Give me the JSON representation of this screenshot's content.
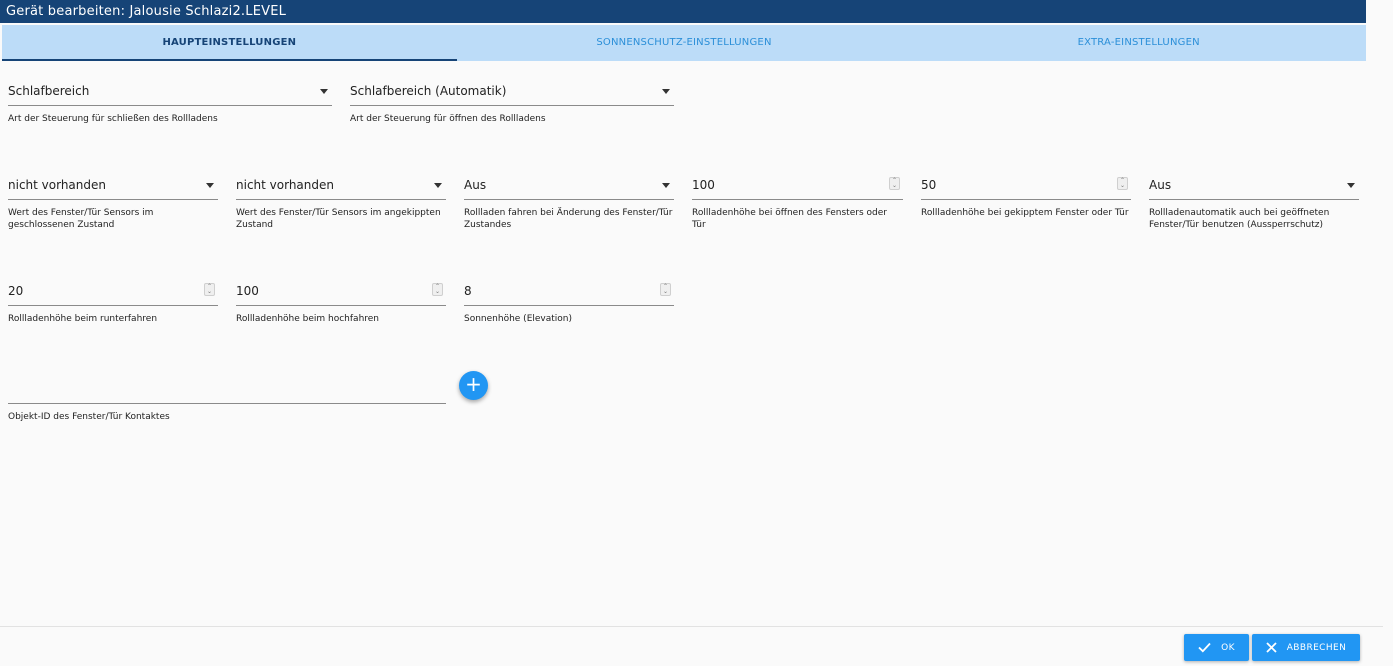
{
  "dialog": {
    "title": "Gerät bearbeiten: Jalousie Schlazi2.LEVEL"
  },
  "tabs": [
    {
      "label": "Haupteinstellungen",
      "active": true
    },
    {
      "label": "Sonnenschutz-Einstellungen",
      "active": false
    },
    {
      "label": "Extra-Einstellungen",
      "active": false
    }
  ],
  "row1": [
    {
      "value": "Schlafbereich",
      "helper": "Art der Steuerung für schließen des Rollladens"
    },
    {
      "value": "Schlafbereich (Automatik)",
      "helper": "Art der Steuerung für öffnen des Rollladens"
    }
  ],
  "row2": [
    {
      "value": "nicht vorhanden",
      "helper": "Wert des Fenster/Tür Sensors im geschlossenen Zustand"
    },
    {
      "value": "nicht vorhanden",
      "helper": "Wert des Fenster/Tür Sensors im angekippten Zustand"
    },
    {
      "value": "Aus",
      "helper": "Rollladen fahren bei Änderung des Fenster/Tür Zustandes"
    },
    {
      "value": "100",
      "helper": "Rollladenhöhe bei öffnen des Fensters oder Tür"
    },
    {
      "value": "50",
      "helper": "Rollladenhöhe bei gekipptem Fenster oder Tür"
    },
    {
      "value": "Aus",
      "helper": "Rollladenautomatik auch bei geöffneten Fenster/Tür benutzen (Aussperrschutz)"
    }
  ],
  "row3": [
    {
      "value": "20",
      "helper": "Rollladenhöhe beim runterfahren"
    },
    {
      "value": "100",
      "helper": "Rollladenhöhe beim hochfahren"
    },
    {
      "value": "8",
      "helper": "Sonnenhöhe (Elevation)"
    }
  ],
  "contact": {
    "value": "",
    "helper": "Objekt-ID des Fenster/Tür Kontaktes"
  },
  "add_button": {
    "glyph": "+"
  },
  "footer": {
    "ok_label": "OK",
    "cancel_label": "ABBRECHEN"
  },
  "colors": {
    "title_bar": "#164477",
    "tab_bar": "#bcdcf8",
    "accent": "#2196f3"
  }
}
